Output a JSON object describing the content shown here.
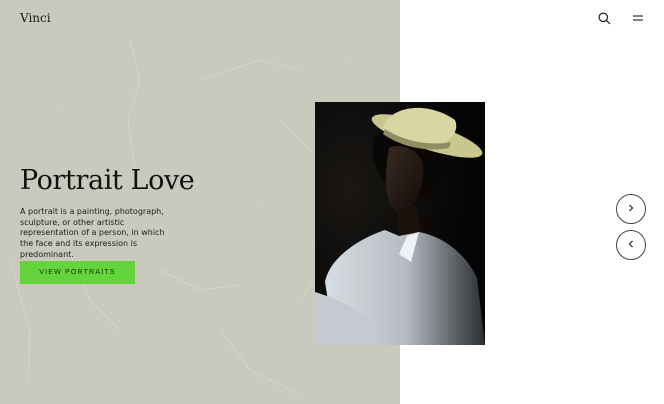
{
  "brand": {
    "name": "Vinci"
  },
  "header": {
    "icons": [
      "search-icon",
      "menu-icon"
    ]
  },
  "hero": {
    "title": "Portrait Love",
    "description": "A portrait is a painting, photograph, sculpture, or other artistic representation of a person, in which the face and its expression is predominant.",
    "cta_label": "VIEW PORTRAITS"
  },
  "colors": {
    "panel": "#c9c9bd",
    "accent": "#63d43c",
    "text": "#111111",
    "background": "#ffffff"
  },
  "carousel": {
    "next_icon": "chevron-right-icon",
    "prev_icon": "chevron-left-icon"
  }
}
